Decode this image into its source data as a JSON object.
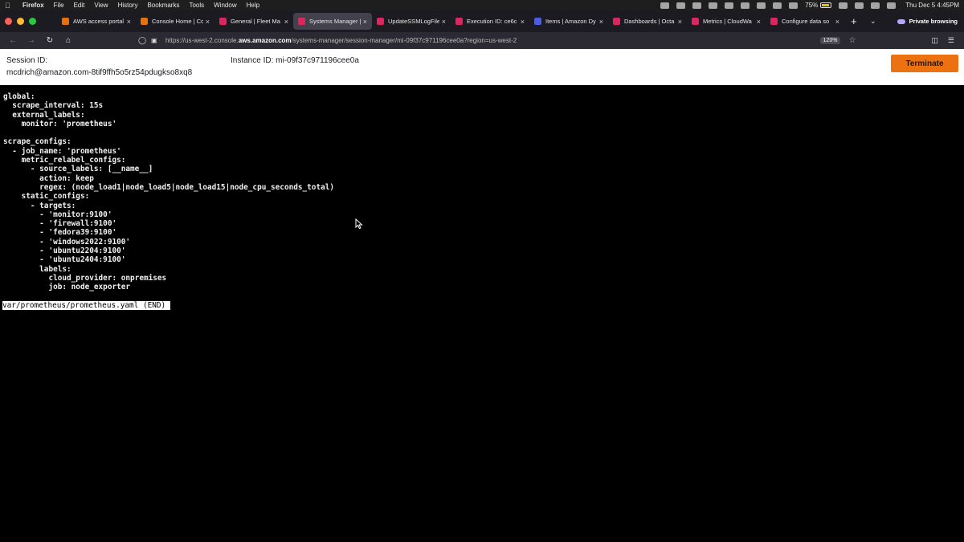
{
  "menubar": {
    "app_name": "Firefox",
    "menus": [
      "File",
      "Edit",
      "View",
      "History",
      "Bookmarks",
      "Tools",
      "Window",
      "Help"
    ],
    "battery_percent": "75%",
    "clock": "Thu Dec 5  4:45PM"
  },
  "tabs": [
    {
      "title": "AWS access portal",
      "color": "#e8710a",
      "active": false
    },
    {
      "title": "Console Home | Co",
      "color": "#e8710a",
      "active": false
    },
    {
      "title": "General | Fleet Ma",
      "color": "#e0245e",
      "active": false
    },
    {
      "title": "Systems Manager |",
      "color": "#e0245e",
      "active": true
    },
    {
      "title": "UpdateSSMLogFile",
      "color": "#e0245e",
      "active": false
    },
    {
      "title": "Execution ID: ce6c",
      "color": "#e0245e",
      "active": false
    },
    {
      "title": "Items | Amazon Dy",
      "color": "#4b5ce8",
      "active": false
    },
    {
      "title": "Dashboards | Octa",
      "color": "#e0245e",
      "active": false
    },
    {
      "title": "Metrics | CloudWa",
      "color": "#e0245e",
      "active": false
    },
    {
      "title": "Configure data so",
      "color": "#e0245e",
      "active": false
    }
  ],
  "private_label": "Private browsing",
  "navbar": {
    "url_prefix": "https://us-west-2.console.",
    "url_domain": "aws.amazon.com",
    "url_suffix": "/systems-manager/session-manager/mi-09f37c971196cee0a?region=us-west-2",
    "zoom": "120%"
  },
  "session": {
    "session_id_label": "Session ID:",
    "session_id_value": "mcdrich@amazon.com-8tif9ffh5o5rz54pdugkso8xq8",
    "instance_id": "Instance ID: mi-09f37c971196cee0a",
    "terminate_label": "Terminate"
  },
  "terminal": {
    "lines": [
      "global:",
      "  scrape_interval: 15s",
      "  external_labels:",
      "    monitor: 'prometheus'",
      "",
      "scrape_configs:",
      "  - job_name: 'prometheus'",
      "    metric_relabel_configs:",
      "      - source_labels: [__name__]",
      "        action: keep",
      "        regex: (node_load1|node_load5|node_load15|node_cpu_seconds_total)",
      "    static_configs:",
      "      - targets:",
      "        - 'monitor:9100'",
      "        - 'firewall:9100'",
      "        - 'fedora39:9100'",
      "        - 'windows2022:9100'",
      "        - 'ubuntu2204:9100'",
      "        - 'ubuntu2404:9100'",
      "        labels:",
      "          cloud_provider: onpremises",
      "          job: node_exporter"
    ],
    "status_line": "var/prometheus/prometheus.yaml (END)"
  }
}
